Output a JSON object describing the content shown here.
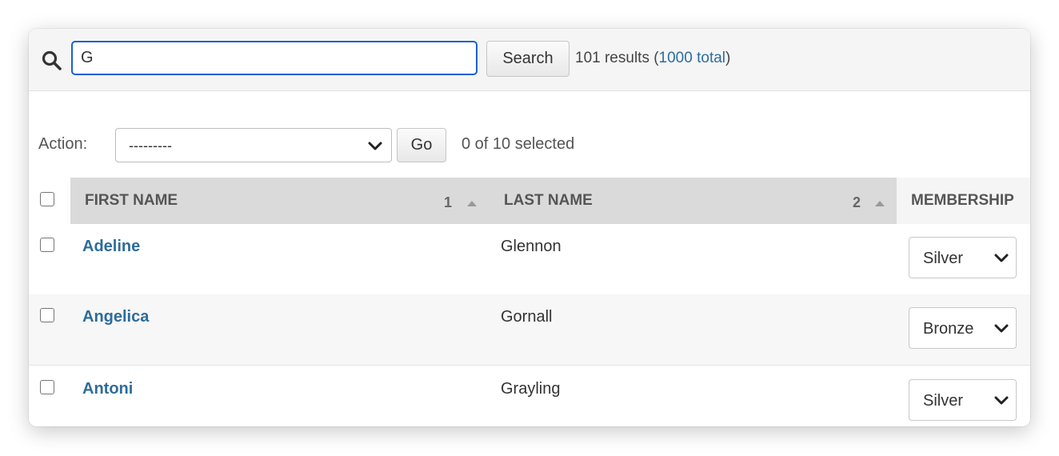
{
  "search": {
    "value": "G",
    "button_label": "Search",
    "results_prefix": "101 results (",
    "total_link": "1000 total",
    "results_suffix": ")"
  },
  "actions": {
    "label": "Action:",
    "selected_value": "---------",
    "go_label": "Go",
    "selected_count": "0 of 10 selected"
  },
  "table": {
    "columns": [
      {
        "label": "First name",
        "sort_priority": "1"
      },
      {
        "label": "Last name",
        "sort_priority": "2"
      },
      {
        "label": "Membership"
      }
    ],
    "rows": [
      {
        "first_name": "Adeline",
        "last_name": "Glennon",
        "membership": "Silver"
      },
      {
        "first_name": "Angelica",
        "last_name": "Gornall",
        "membership": "Bronze"
      },
      {
        "first_name": "Antoni",
        "last_name": "Grayling",
        "membership": "Silver"
      }
    ]
  },
  "colors": {
    "link": "#2e6c9a",
    "focus_border": "#1b5fd8",
    "header_bg": "#dadada",
    "toolbar_bg": "#f5f5f5"
  }
}
